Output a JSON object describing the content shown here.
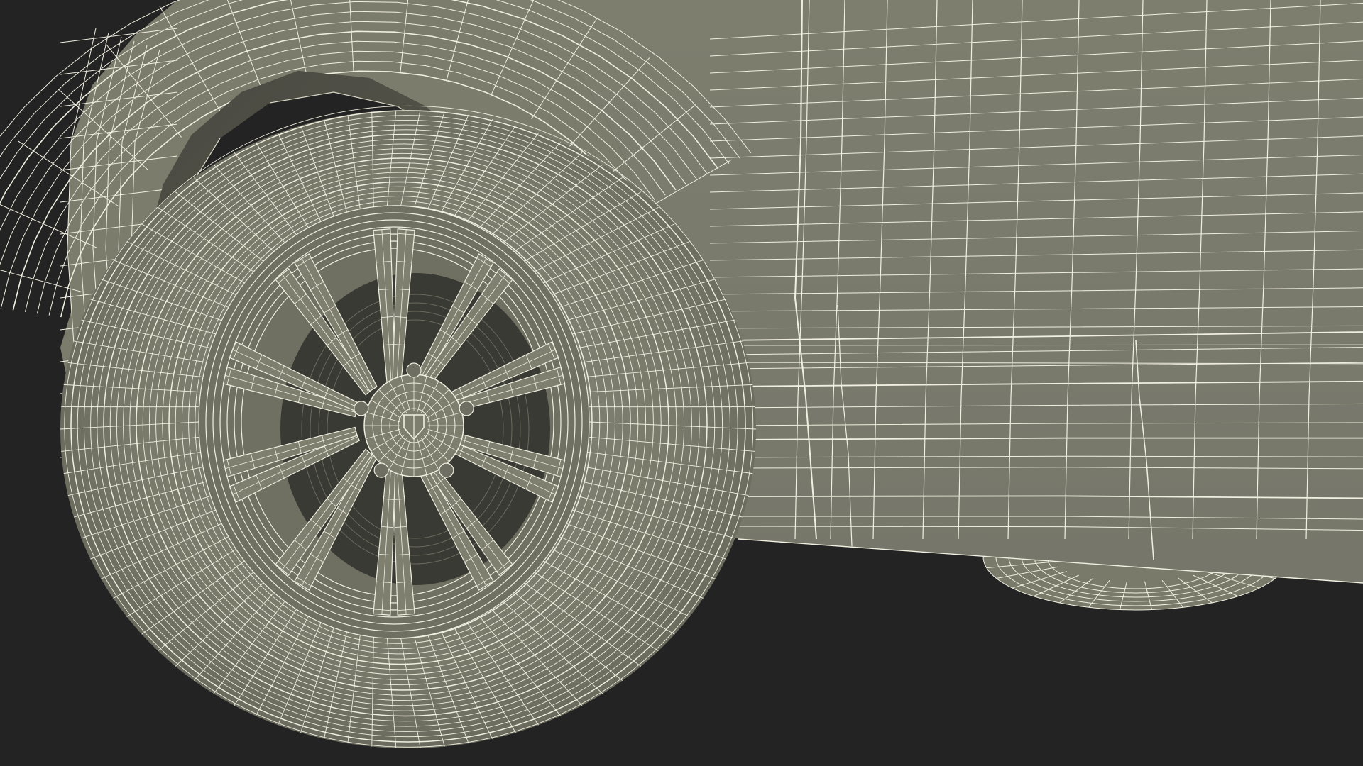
{
  "scene": {
    "subject": "car-front-wheel-wireframe",
    "colors": {
      "background": "#232323",
      "surface": "#7b7b6c",
      "surface_dark": "#5f5f54",
      "surface_shadow": "#3e3e37",
      "wire": "#f1efe0",
      "wire_dim": "#d9d6c4"
    },
    "wheel": {
      "spokes": 10
    }
  }
}
